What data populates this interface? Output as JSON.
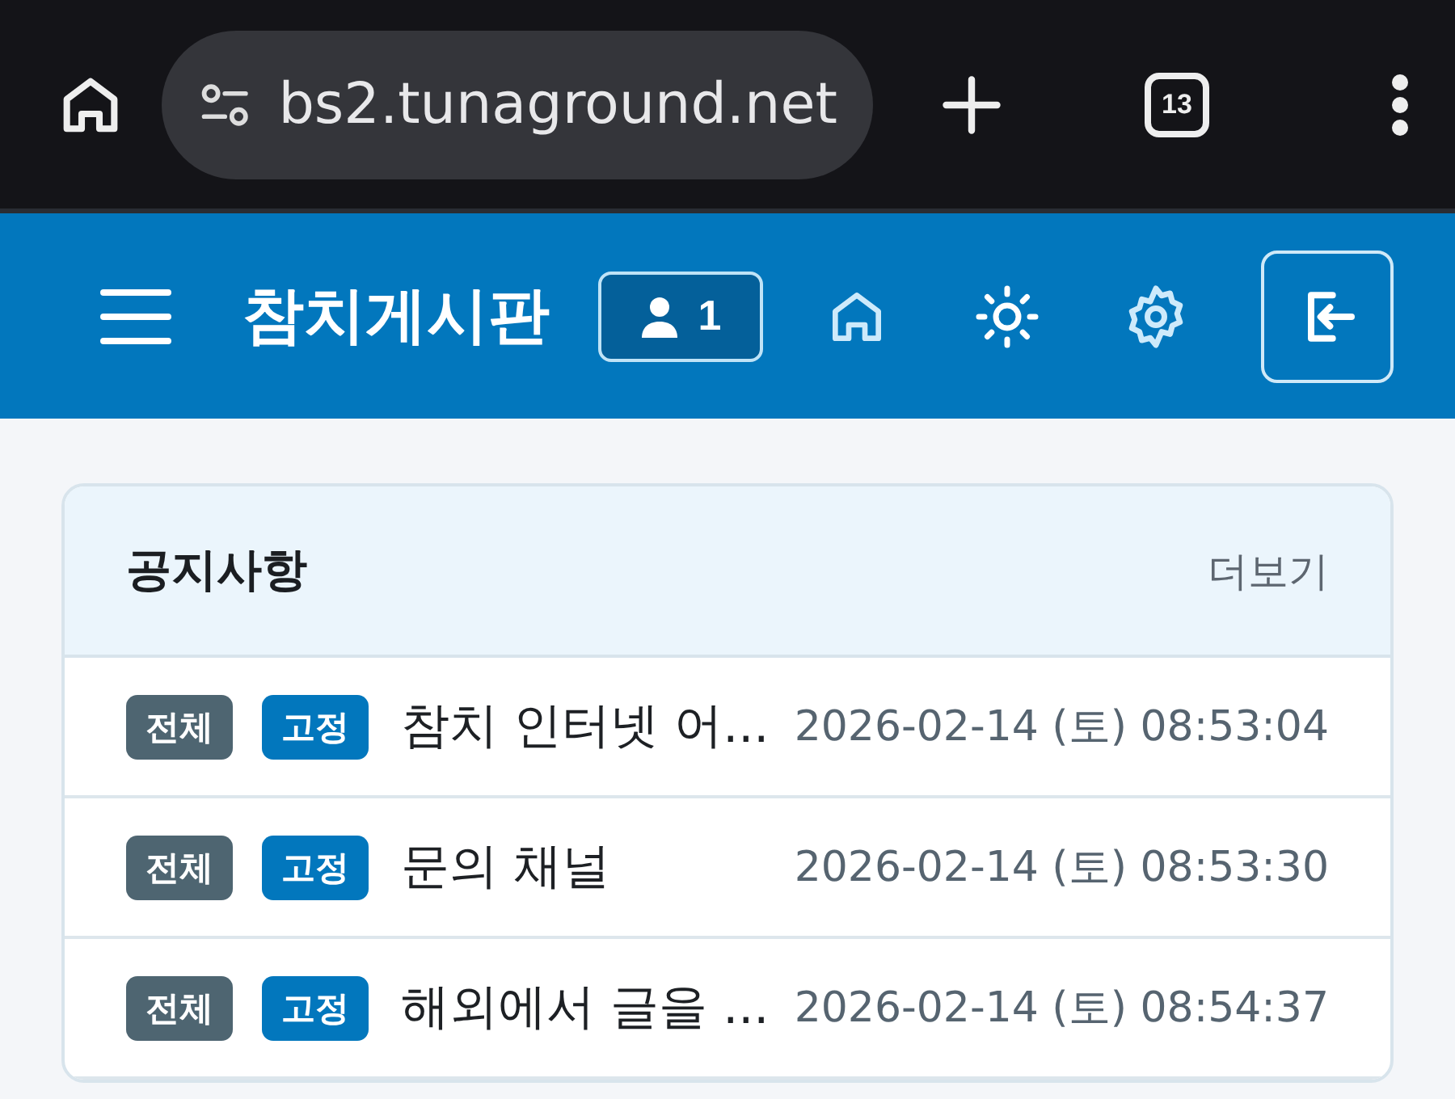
{
  "browser": {
    "url": "bs2.tunaground.net",
    "tab_count": "13"
  },
  "header": {
    "title": "참치게시판",
    "user_count": "1"
  },
  "notices": {
    "title": "공지사항",
    "more": "더보기",
    "rows": [
      {
        "badges": [
          {
            "kind": "category",
            "label": "전체"
          },
          {
            "kind": "pinned",
            "label": "고정"
          }
        ],
        "title": "참치 인터넷 어...",
        "date": "2026-02-14 (토) 08:53:04"
      },
      {
        "badges": [
          {
            "kind": "category",
            "label": "전체"
          },
          {
            "kind": "pinned",
            "label": "고정"
          }
        ],
        "title": "문의 채널",
        "date": "2026-02-14 (토) 08:53:30"
      },
      {
        "badges": [
          {
            "kind": "category",
            "label": "전체"
          },
          {
            "kind": "pinned",
            "label": "고정"
          }
        ],
        "title": "해외에서 글을 ...",
        "date": "2026-02-14 (토) 08:54:37"
      }
    ]
  }
}
